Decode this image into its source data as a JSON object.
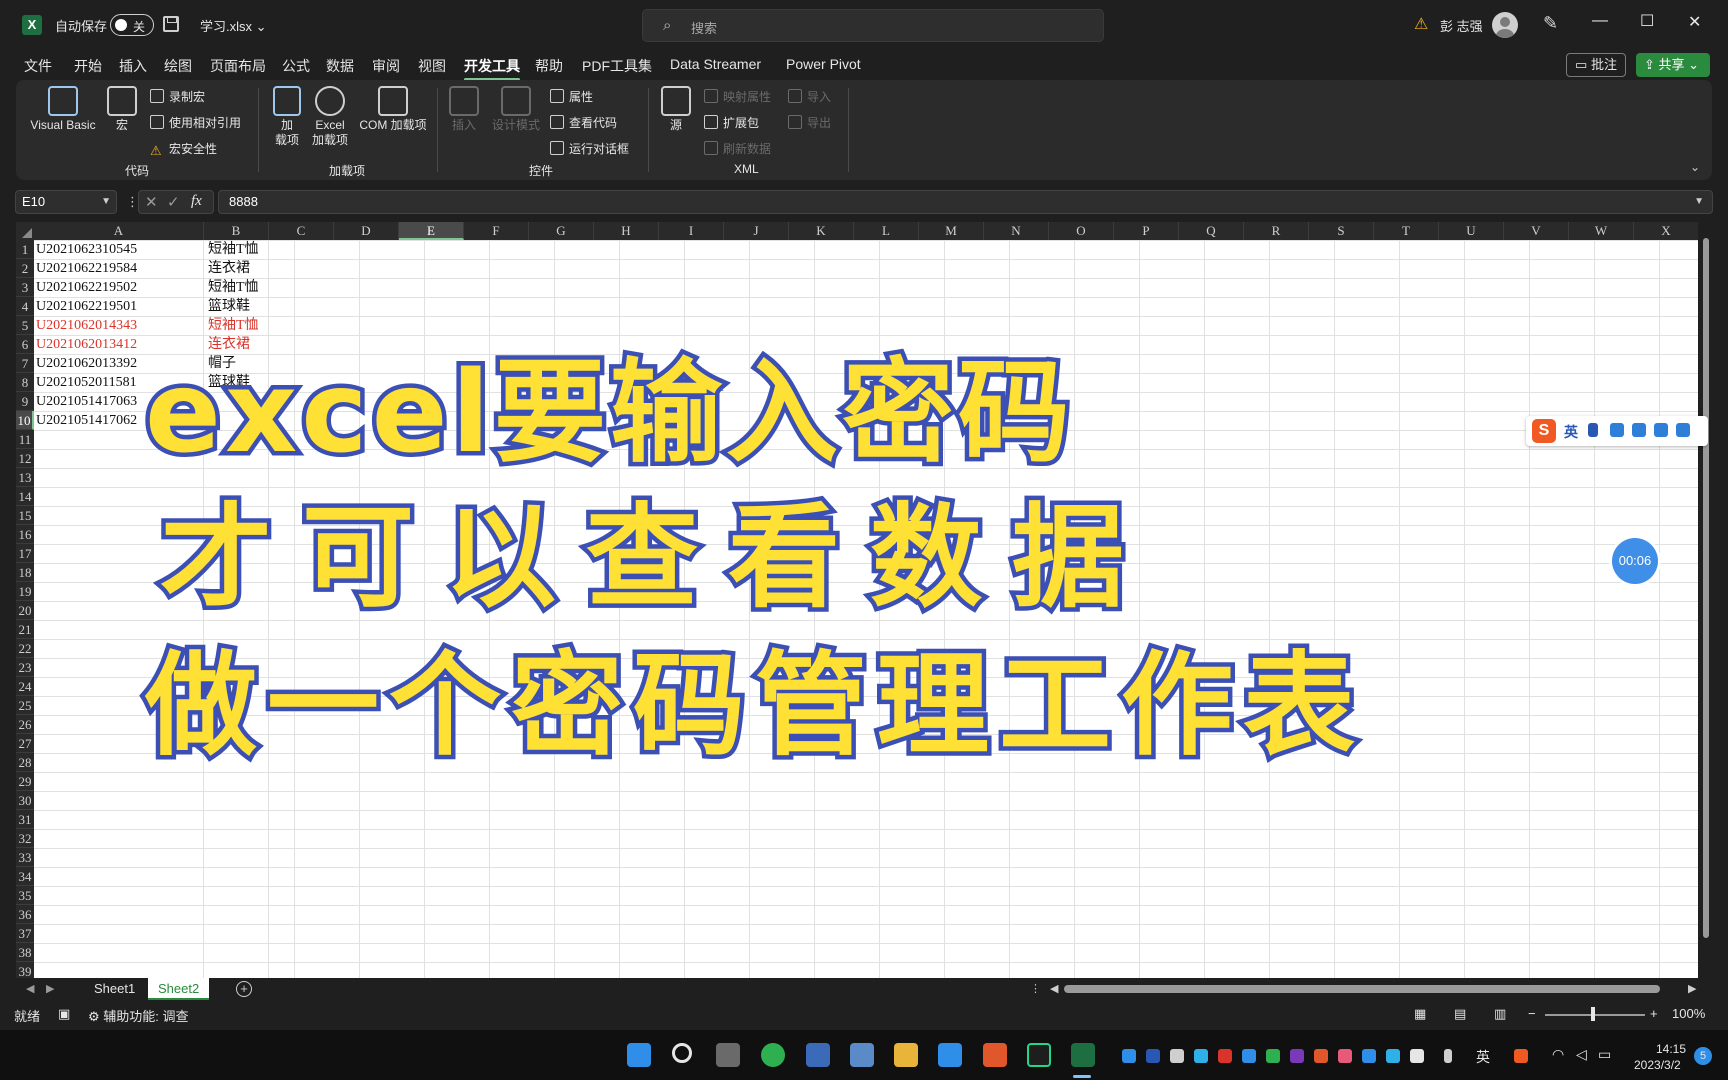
{
  "titlebar": {
    "autosave_label": "自动保存",
    "autosave_state": "关",
    "filename": "学习.xlsx",
    "search_placeholder": "搜索",
    "user_name": "彭 志强"
  },
  "tabs": [
    "文件",
    "开始",
    "插入",
    "绘图",
    "页面布局",
    "公式",
    "数据",
    "审阅",
    "视图",
    "开发工具",
    "帮助",
    "PDF工具集",
    "Data Streamer",
    "Power Pivot"
  ],
  "active_tab": "开发工具",
  "header_buttons": {
    "comment": "批注",
    "share": "共享"
  },
  "ribbon": {
    "code": {
      "visual_basic": "Visual Basic",
      "macro": "宏",
      "record_macro": "录制宏",
      "relative_ref": "使用相对引用",
      "macro_security": "宏安全性",
      "label": "代码"
    },
    "addins": {
      "addin": "加\n载项",
      "excel_addin": "Excel\n加载项",
      "com_addin": "COM 加载项",
      "label": "加载项"
    },
    "controls": {
      "insert": "插入",
      "design_mode": "设计模式",
      "properties": "属性",
      "view_code": "查看代码",
      "run_dialog": "运行对话框",
      "label": "控件"
    },
    "xml": {
      "source": "源",
      "map_props": "映射属性",
      "expansion": "扩展包",
      "refresh": "刷新数据",
      "import": "导入",
      "export": "导出",
      "label": "XML"
    }
  },
  "formula_bar": {
    "name_box": "E10",
    "fx": "fx",
    "value": "8888"
  },
  "columns": [
    "A",
    "B",
    "C",
    "D",
    "E",
    "F",
    "G",
    "H",
    "I",
    "J",
    "K",
    "L",
    "M",
    "N",
    "O",
    "P",
    "Q",
    "R",
    "S",
    "T",
    "U",
    "V",
    "W",
    "X"
  ],
  "selected_column": "E",
  "selected_row": "10",
  "rows": [
    "1",
    "2",
    "3",
    "4",
    "5",
    "6",
    "7",
    "8",
    "9",
    "10",
    "11",
    "12",
    "13",
    "14",
    "15",
    "16",
    "17",
    "18",
    "19",
    "20",
    "21",
    "22",
    "23",
    "24",
    "25",
    "26",
    "27",
    "28",
    "29",
    "30",
    "31",
    "32",
    "33",
    "34",
    "35",
    "36",
    "37",
    "38",
    "39"
  ],
  "cells": [
    {
      "a": "U2021062310545",
      "b": "短袖T恤",
      "red": false
    },
    {
      "a": "U2021062219584",
      "b": "连衣裙",
      "red": false
    },
    {
      "a": "U2021062219502",
      "b": "短袖T恤",
      "red": false
    },
    {
      "a": "U2021062219501",
      "b": "篮球鞋",
      "red": false
    },
    {
      "a": "U2021062014343",
      "b": "短袖T恤",
      "red": true
    },
    {
      "a": "U2021062013412",
      "b": "连衣裙",
      "red": true
    },
    {
      "a": "U2021062013392",
      "b": "帽子",
      "red": false
    },
    {
      "a": "U2021052011581",
      "b": "篮球鞋",
      "red": false
    },
    {
      "a": "U2021051417063",
      "b": "",
      "red": false
    },
    {
      "a": "U2021051417062",
      "b": "",
      "red": false
    }
  ],
  "overlay": {
    "line1": "excel要输入密码",
    "line2": "才可以查看数据",
    "line3": "做一个密码管理工作表"
  },
  "ime": {
    "lang": "英"
  },
  "timer": "00:06",
  "sheets": [
    "Sheet1",
    "Sheet2"
  ],
  "active_sheet": "Sheet2",
  "status": {
    "ready": "就绪",
    "accessibility": "辅助功能: 调查",
    "zoom": "100%"
  },
  "taskbar": {
    "lang": "英",
    "time": "14:15",
    "date": "2023/3/2",
    "notif_count": "5"
  }
}
